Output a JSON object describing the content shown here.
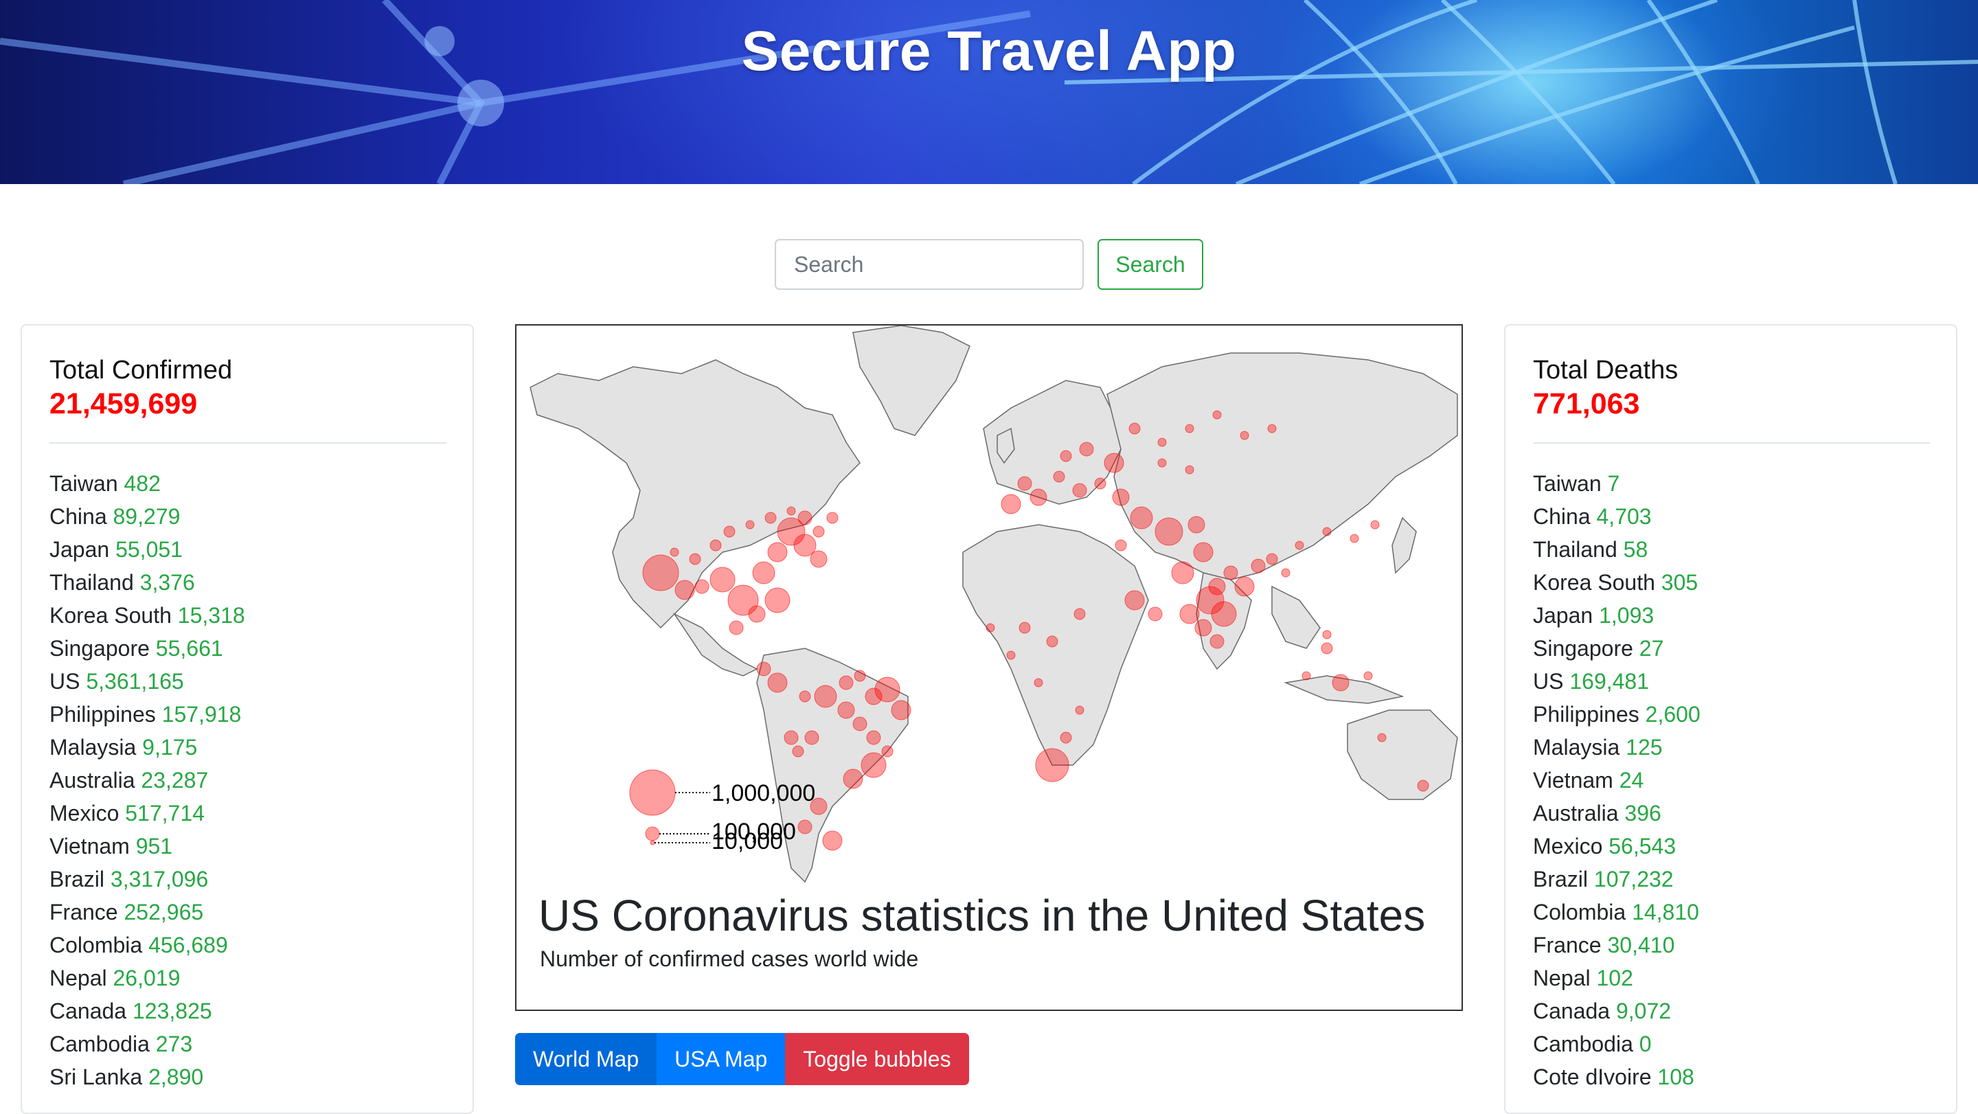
{
  "header": {
    "title": "Secure Travel App"
  },
  "search": {
    "placeholder": "Search",
    "button_label": "Search"
  },
  "confirmed": {
    "title": "Total Confirmed",
    "total": "21,459,699",
    "items": [
      {
        "country": "Taiwan",
        "value": "482"
      },
      {
        "country": "China",
        "value": "89,279"
      },
      {
        "country": "Japan",
        "value": "55,051"
      },
      {
        "country": "Thailand",
        "value": "3,376"
      },
      {
        "country": "Korea South",
        "value": "15,318"
      },
      {
        "country": "Singapore",
        "value": "55,661"
      },
      {
        "country": "US",
        "value": "5,361,165"
      },
      {
        "country": "Philippines",
        "value": "157,918"
      },
      {
        "country": "Malaysia",
        "value": "9,175"
      },
      {
        "country": "Australia",
        "value": "23,287"
      },
      {
        "country": "Mexico",
        "value": "517,714"
      },
      {
        "country": "Vietnam",
        "value": "951"
      },
      {
        "country": "Brazil",
        "value": "3,317,096"
      },
      {
        "country": "France",
        "value": "252,965"
      },
      {
        "country": "Colombia",
        "value": "456,689"
      },
      {
        "country": "Nepal",
        "value": "26,019"
      },
      {
        "country": "Canada",
        "value": "123,825"
      },
      {
        "country": "Cambodia",
        "value": "273"
      },
      {
        "country": "Sri Lanka",
        "value": "2,890"
      }
    ]
  },
  "deaths": {
    "title": "Total Deaths",
    "total": "771,063",
    "items": [
      {
        "country": "Taiwan",
        "value": "7"
      },
      {
        "country": "China",
        "value": "4,703"
      },
      {
        "country": "Thailand",
        "value": "58"
      },
      {
        "country": "Korea South",
        "value": "305"
      },
      {
        "country": "Japan",
        "value": "1,093"
      },
      {
        "country": "Singapore",
        "value": "27"
      },
      {
        "country": "US",
        "value": "169,481"
      },
      {
        "country": "Philippines",
        "value": "2,600"
      },
      {
        "country": "Malaysia",
        "value": "125"
      },
      {
        "country": "Vietnam",
        "value": "24"
      },
      {
        "country": "Australia",
        "value": "396"
      },
      {
        "country": "Mexico",
        "value": "56,543"
      },
      {
        "country": "Brazil",
        "value": "107,232"
      },
      {
        "country": "Colombia",
        "value": "14,810"
      },
      {
        "country": "France",
        "value": "30,410"
      },
      {
        "country": "Nepal",
        "value": "102"
      },
      {
        "country": "Canada",
        "value": "9,072"
      },
      {
        "country": "Cambodia",
        "value": "0"
      },
      {
        "country": "Cote dIvoire",
        "value": "108"
      }
    ]
  },
  "map": {
    "title": "US Coronavirus statistics in the United States",
    "subtitle": "Number of confirmed cases world wide",
    "legend": [
      "1,000,000",
      "100,000",
      "10,000"
    ],
    "bubble_color": "#ff0000"
  },
  "buttons": {
    "world_map": "World Map",
    "usa_map": "USA Map",
    "toggle_bubbles": "Toggle bubbles"
  }
}
